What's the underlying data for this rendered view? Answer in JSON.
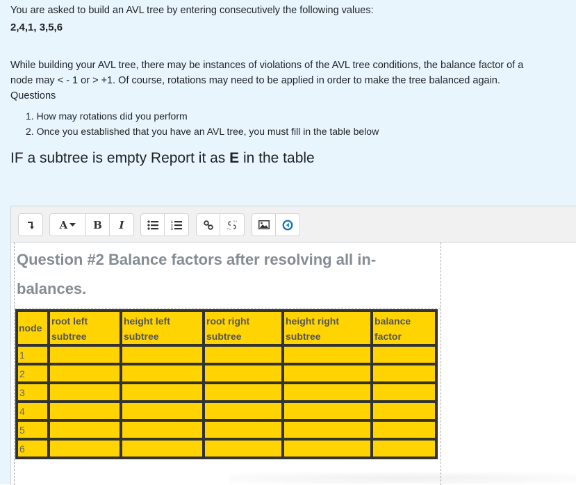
{
  "intro": {
    "line1": "You are asked to build an AVL tree by entering consecutively  the following values:",
    "values": "2,4,1, 3,5,6",
    "para_line1": "While building your AVL tree, there may be instances of violations of the AVL tree conditions, the balance factor of a",
    "para_line2": "node  may   < - 1 or > +1.  Of course, rotations may need to be applied in order to  make the tree balanced again.",
    "questions_label": "Questions",
    "questions": [
      "1. How may rotations  did you perform",
      "2. Once you established that  you have an AVL tree, you must fill in the table below"
    ],
    "empty_note_prefix": "IF a subtree is empty  Report it as ",
    "empty_note_bold": "E",
    "empty_note_suffix": " in the table"
  },
  "toolbar": {
    "buttons": [
      {
        "name": "show-more-buttons",
        "icon": "↴"
      },
      {
        "name": "font-style",
        "icon": "A▾"
      },
      {
        "name": "bold",
        "icon": "B"
      },
      {
        "name": "italic",
        "icon": "I"
      },
      {
        "name": "unordered-list",
        "icon": "☰"
      },
      {
        "name": "ordered-list",
        "icon": "☰"
      },
      {
        "name": "link",
        "icon": "∞"
      },
      {
        "name": "unlink",
        "icon": "✂"
      },
      {
        "name": "insert-image",
        "icon": "▲"
      },
      {
        "name": "media",
        "icon": "◀"
      }
    ],
    "media_icon_color": "#0f6cbf"
  },
  "editor": {
    "heading": "Question #2 Balance factors after resolving all in-balances.",
    "table": {
      "headers": [
        "node",
        "root left subtree",
        "height left subtree",
        "root right subtree",
        "height right subtree",
        "balance factor"
      ],
      "rows": [
        [
          "1",
          "",
          "",
          "",
          "",
          ""
        ],
        [
          "2",
          "",
          "",
          "",
          "",
          ""
        ],
        [
          "3",
          "",
          "",
          "",
          "",
          ""
        ],
        [
          "4",
          "",
          "",
          "",
          "",
          ""
        ],
        [
          "5",
          "",
          "",
          "",
          "",
          ""
        ],
        [
          "6",
          "",
          "",
          "",
          "",
          ""
        ]
      ],
      "cell_color": "#ffd400",
      "border_color": "#333333"
    }
  }
}
